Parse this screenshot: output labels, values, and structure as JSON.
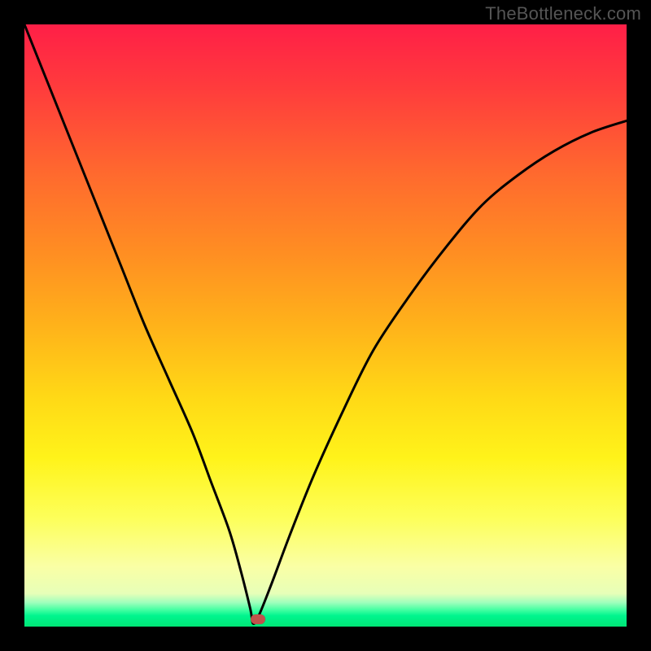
{
  "watermark": "TheBottleneck.com",
  "chart_data": {
    "type": "line",
    "title": "",
    "xlabel": "",
    "ylabel": "",
    "xlim": [
      0,
      100
    ],
    "ylim": [
      0,
      100
    ],
    "grid": false,
    "legend": false,
    "curve": {
      "description": "V-shaped bottleneck curve; minimum near x≈38",
      "x": [
        0,
        4,
        8,
        12,
        16,
        20,
        24,
        28,
        31,
        34,
        36,
        37.5,
        38,
        39,
        41,
        44,
        48,
        53,
        58,
        64,
        70,
        76,
        82,
        88,
        94,
        100
      ],
      "y_pct": [
        100,
        90,
        80,
        70,
        60,
        50,
        41,
        32,
        24,
        16,
        9,
        3,
        0.5,
        2,
        7,
        15,
        25,
        36,
        46,
        55,
        63,
        70,
        75,
        79,
        82,
        84
      ]
    },
    "marker": {
      "shape": "rounded-rect",
      "x": 38.8,
      "y_pct": 1.2,
      "color": "#c0524b"
    },
    "gradient_stops": [
      {
        "pos": 0,
        "color": "#ff1f47"
      },
      {
        "pos": 0.5,
        "color": "#ffb21a"
      },
      {
        "pos": 0.72,
        "color": "#fff31a"
      },
      {
        "pos": 0.94,
        "color": "#e7ffb8"
      },
      {
        "pos": 1.0,
        "color": "#00e676"
      }
    ]
  }
}
